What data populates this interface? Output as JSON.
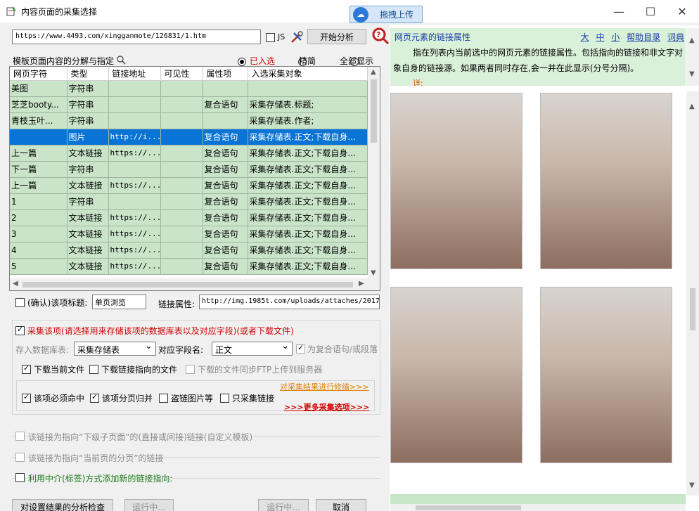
{
  "window": {
    "title": "内容页面的采集选择",
    "upload_button": "拖拽上传",
    "controls": [
      "—",
      "☐",
      "✕"
    ]
  },
  "toolbar": {
    "url": "https://www.4493.com/xingganmote/126831/1.htm",
    "js_label": "JS",
    "analyze_button": "开始分析"
  },
  "template": {
    "label": "模板页面内容的分解与指定",
    "radio_selected": "已入选",
    "radio_simple": "精简",
    "radio_all": "全部显示"
  },
  "grid": {
    "headers": [
      "网页字符",
      "类型",
      "链接地址",
      "可见性",
      "属性项",
      "入选采集对象"
    ],
    "rows": [
      [
        "美图",
        "字符串",
        "",
        "",
        "",
        ""
      ],
      [
        "芝芝booty...",
        "字符串",
        "",
        "",
        "复合语句",
        "采集存储表.标题;"
      ],
      [
        "青枝玉叶...",
        "字符串",
        "",
        "",
        "",
        "采集存储表.作者;"
      ],
      [
        "",
        "图片",
        "http://i...",
        "",
        "复合语句",
        "采集存储表.正文;下载自身..."
      ],
      [
        "上一篇",
        "文本链接",
        "https://...",
        "",
        "复合语句",
        "采集存储表.正文;下载自身..."
      ],
      [
        "下一篇",
        "字符串",
        "",
        "",
        "复合语句",
        "采集存储表.正文;下载自身..."
      ],
      [
        "上一篇",
        "文本链接",
        "https://...",
        "",
        "复合语句",
        "采集存储表.正文;下载自身..."
      ],
      [
        "1",
        "字符串",
        "",
        "",
        "复合语句",
        "采集存储表.正文;下载自身..."
      ],
      [
        "2",
        "文本链接",
        "https://...",
        "",
        "复合语句",
        "采集存储表.正文;下载自身..."
      ],
      [
        "3",
        "文本链接",
        "https://...",
        "",
        "复合语句",
        "采集存储表.正文;下载自身..."
      ],
      [
        "4",
        "文本链接",
        "https://...",
        "",
        "复合语句",
        "采集存储表.正文;下载自身..."
      ],
      [
        "5",
        "文本链接",
        "https://...",
        "",
        "复合语句",
        "采集存储表.正文;下载自身..."
      ]
    ]
  },
  "confirm": {
    "title_label": "(确认)该项标题:",
    "title_value": "单页浏览",
    "attr_label": "链接属性:",
    "attr_value": "http://img.1985t.com/uploads/attaches/2017"
  },
  "collect": {
    "label": "采集该项(请选择用来存储该项的数据库表以及对应字段)(或者下载文件)",
    "db_label": "存入数据库表:",
    "db_value": "采集存储表",
    "field_label": "对应字段名:",
    "field_value": "正文",
    "compound_label": "为复合语句/或段落",
    "download_current": "下载当前文件",
    "download_link": "下载链接指向的文件",
    "ftp_label": "下载的文件同步FTP上传到服务器",
    "must_hit": "该项必须命中",
    "merge_pages": "该项分页归并",
    "hotlink": "盗链图片等",
    "only_link": "只采集链接",
    "modify_link": "对采集结果进行修缮>>>",
    "more_link": ">>>更多采集选项>>>"
  },
  "sections": {
    "sub_page": "该链接为指向“下级子页面”的(直接或间接)链接(自定义模板)",
    "paging": "该链接为指向“当前页的分页”的链接",
    "tag_link": "利用中介(标签)方式添加新的链接指向:"
  },
  "footer": {
    "check_button": "对设置结果的分析检查",
    "running1": "运行中...",
    "running2": "运行中...",
    "cancel": "取消"
  },
  "help": {
    "title": "网页元素的链接属性",
    "size_links": [
      "大",
      "中",
      "小"
    ],
    "help_dir": "帮助目录",
    "dictionary": "词典",
    "text": "指在列表内当前选中的网页元素的链接属性。包括指向的链接和非文字对象自身的链接源。如果两者同时存在,会一并在此显示(分号分隔)。",
    "detail": "详:"
  },
  "colors": {
    "grid_row": "#c9e4c9",
    "selected_row": "#0a74d6",
    "help_bg": "#d9f0d9"
  }
}
